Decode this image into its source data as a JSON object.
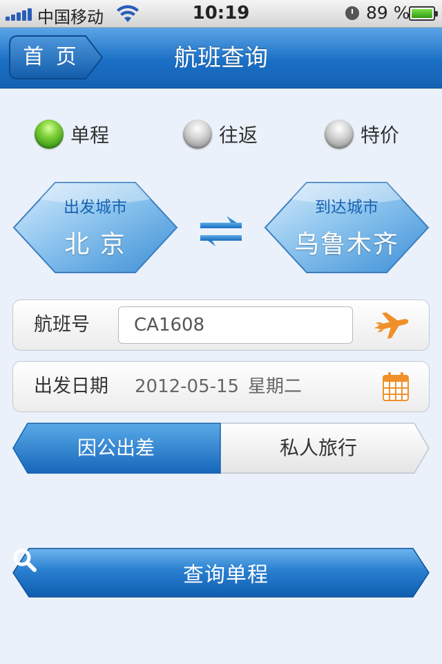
{
  "status_bar": {
    "carrier": "中国移动",
    "time": "10:19",
    "battery": "89 %"
  },
  "nav": {
    "back_label": "首 页",
    "title": "航班查询"
  },
  "trip_type": {
    "options": [
      {
        "label": "单程",
        "selected": true
      },
      {
        "label": "往返",
        "selected": false
      },
      {
        "label": "特价",
        "selected": false
      }
    ]
  },
  "departure": {
    "caption": "出发城市",
    "city": "北 京"
  },
  "arrival": {
    "caption": "到达城市",
    "city": "乌鲁木齐"
  },
  "flight_no": {
    "label": "航班号",
    "value": "CA1608"
  },
  "date": {
    "label": "出发日期",
    "value": "2012-05-15",
    "weekday": "星期二"
  },
  "travel_purpose": {
    "options": [
      {
        "label": "因公出差",
        "selected": true
      },
      {
        "label": "私人旅行",
        "selected": false
      }
    ]
  },
  "search_button": {
    "label": "查询单程"
  },
  "colors": {
    "accent_blue": "#1b6fc5",
    "city_caption": "#1862b0",
    "icon_orange": "#f0902a",
    "radio_on": "#4fb320"
  }
}
